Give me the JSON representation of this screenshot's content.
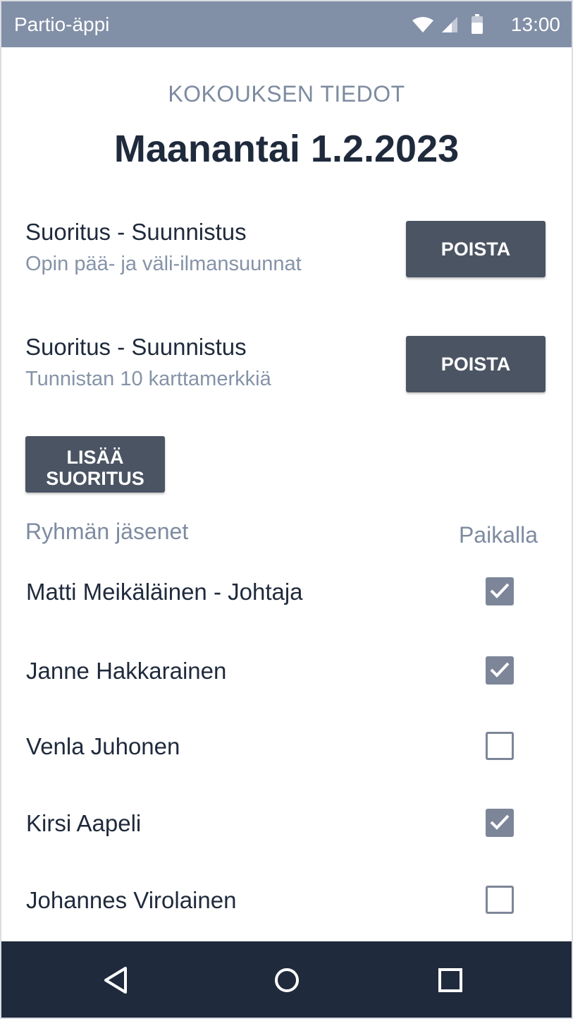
{
  "status_bar": {
    "app_title": "Partio-äppi",
    "time": "13:00",
    "icons": [
      "wifi-icon",
      "signal-icon",
      "battery-icon"
    ]
  },
  "meeting": {
    "section_title": "KOKOUKSEN TIEDOT",
    "date": "Maanantai 1.2.2023"
  },
  "achievements": [
    {
      "title": "Suoritus - Suunnistus",
      "subtitle": "Opin pää- ja väli-ilmansuunnat",
      "remove_label": "POISTA"
    },
    {
      "title": "Suoritus - Suunnistus",
      "subtitle": "Tunnistan 10 karttamerkkiä",
      "remove_label": "POISTA"
    }
  ],
  "add_achievement": {
    "line1": "LISÄÄ",
    "line2": "SUORITUS"
  },
  "members": {
    "header_label": "Ryhmän jäsenet",
    "present_label": "Paikalla",
    "list": [
      {
        "name": "Matti Meikäläinen - Johtaja",
        "present": true
      },
      {
        "name": "Janne Hakkarainen",
        "present": true
      },
      {
        "name": "Venla Juhonen",
        "present": false
      },
      {
        "name": "Kirsi Aapeli",
        "present": true
      },
      {
        "name": "Johannes Virolainen",
        "present": false
      }
    ]
  },
  "nav_bar": {
    "icons": [
      "back-icon",
      "home-icon",
      "recents-icon"
    ]
  },
  "colors": {
    "status_bar": "#818fa7",
    "button": "#4b5463",
    "nav_bar": "#1f2a3c",
    "muted_text": "#7d8ba0",
    "checkbox": "#7d8698"
  }
}
